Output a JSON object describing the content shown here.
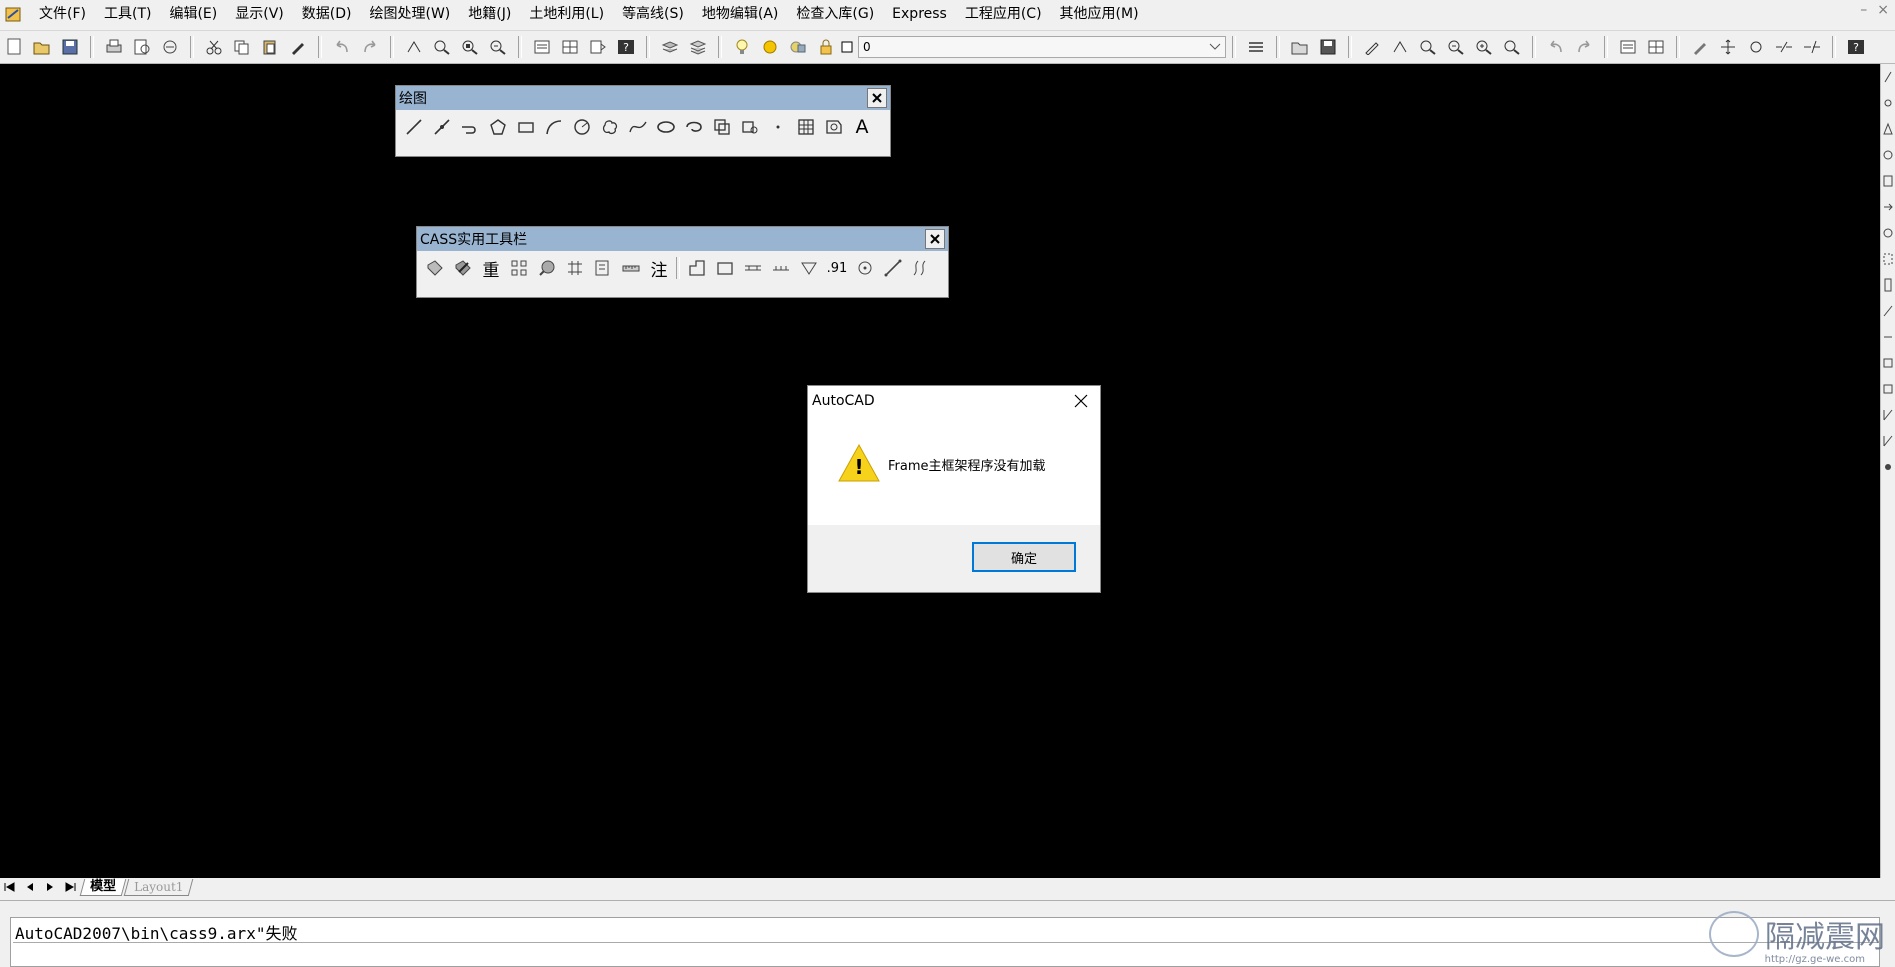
{
  "menubar": {
    "items": [
      "文件(F)",
      "工具(T)",
      "编辑(E)",
      "显示(V)",
      "数据(D)",
      "绘图处理(W)",
      "地籍(J)",
      "土地利用(L)",
      "等高线(S)",
      "地物编辑(A)",
      "检查入库(G)",
      "Express",
      "工程应用(C)",
      "其他应用(M)"
    ],
    "minimize": "–",
    "close": "×"
  },
  "toolbar": {
    "layer_value": "0"
  },
  "draw_toolbar": {
    "title": "绘图",
    "text_tool": "A"
  },
  "cass_toolbar": {
    "title": "CASS实用工具栏",
    "heavy_label": "重",
    "annotate_label": "注",
    "elev_label": ".91"
  },
  "dialog": {
    "title": "AutoCAD",
    "message": "Frame主框架程序没有加载",
    "ok_label": "确定",
    "warning_glyph": "!"
  },
  "tabs": {
    "model": "模型",
    "layout1": "Layout1"
  },
  "command": {
    "line1": "AutoCAD2007\\bin\\cass9.arx\"失败"
  },
  "watermark": {
    "text": "隔减震网",
    "url": "http://gz.ge-we.com"
  },
  "colors": {
    "canvas": "#000000",
    "title_bar": "#99b4d1",
    "dialog_accent": "#0078d7",
    "warning": "#f7d21b"
  }
}
